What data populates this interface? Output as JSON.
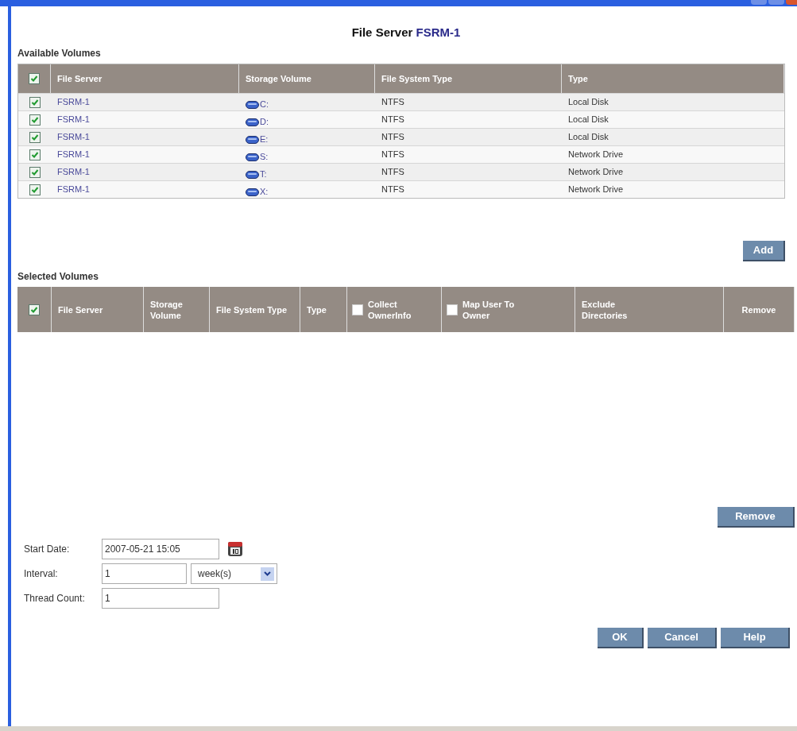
{
  "title": {
    "prefix": "File Server",
    "name": "FSRM-1"
  },
  "available": {
    "label": "Available Volumes",
    "select_all_checked": true,
    "columns": [
      "File Server",
      "Storage Volume",
      "File System Type",
      "Type"
    ],
    "rows": [
      {
        "checked": true,
        "file_server": "FSRM-1",
        "volume": "C:",
        "fs_type": "NTFS",
        "type": "Local Disk"
      },
      {
        "checked": true,
        "file_server": "FSRM-1",
        "volume": "D:",
        "fs_type": "NTFS",
        "type": "Local Disk"
      },
      {
        "checked": true,
        "file_server": "FSRM-1",
        "volume": "E:",
        "fs_type": "NTFS",
        "type": "Local Disk"
      },
      {
        "checked": true,
        "file_server": "FSRM-1",
        "volume": "S:",
        "fs_type": "NTFS",
        "type": "Network Drive"
      },
      {
        "checked": true,
        "file_server": "FSRM-1",
        "volume": "T:",
        "fs_type": "NTFS",
        "type": "Network Drive"
      },
      {
        "checked": true,
        "file_server": "FSRM-1",
        "volume": "X:",
        "fs_type": "NTFS",
        "type": "Network Drive"
      }
    ]
  },
  "add_button": "Add",
  "selected": {
    "label": "Selected Volumes",
    "select_all_checked": true,
    "columns": [
      {
        "kind": "text",
        "label": "File Server"
      },
      {
        "kind": "text",
        "label": "Storage Volume"
      },
      {
        "kind": "text",
        "label": "File System Type"
      },
      {
        "kind": "text",
        "label": "Type"
      },
      {
        "kind": "checkbox",
        "label": "Collect OwnerInfo",
        "checked": false
      },
      {
        "kind": "checkbox",
        "label": "Map User To Owner",
        "checked": false
      },
      {
        "kind": "text",
        "label": "Exclude Directories"
      },
      {
        "kind": "text",
        "label": "Remove"
      }
    ]
  },
  "remove_button": "Remove",
  "form": {
    "start_date_label": "Start Date:",
    "start_date": "2007-05-21 15:05",
    "interval_label": "Interval:",
    "interval": "1",
    "interval_unit": "week(s)",
    "thread_count_label": "Thread Count:",
    "thread_count": "1"
  },
  "footer_buttons": [
    "OK",
    "Cancel",
    "Help"
  ]
}
